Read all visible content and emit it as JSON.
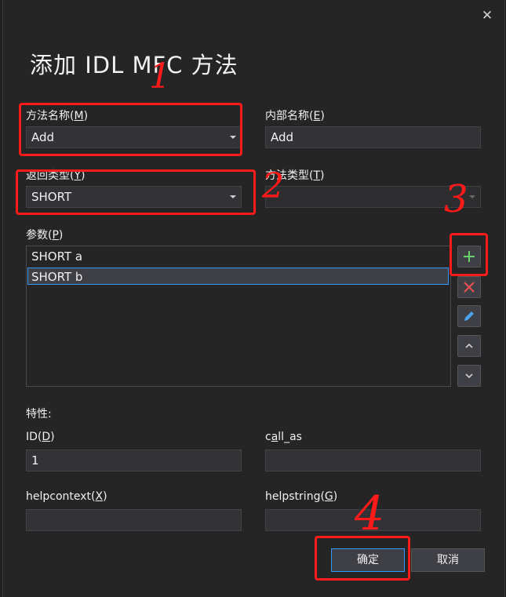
{
  "dialog": {
    "title": "添加 IDL MFC 方法",
    "close_glyph": "✕"
  },
  "method_name": {
    "label": "方法名称(",
    "key": "M",
    "suffix": ")",
    "value": "Add"
  },
  "internal_name": {
    "label": "内部名称(",
    "key": "E",
    "suffix": ")",
    "value": "Add"
  },
  "return_type": {
    "label": "返回类型(",
    "key": "Y",
    "suffix": ")",
    "value": "SHORT"
  },
  "method_type": {
    "label": "方法类型(",
    "key": "T",
    "suffix": ")",
    "value": ""
  },
  "parameters": {
    "label": "参数(",
    "key": "P",
    "suffix": ")",
    "items": [
      "SHORT  a",
      "SHORT b"
    ],
    "selected_index": 1
  },
  "side_buttons": [
    {
      "name": "add",
      "icon": "plus-icon",
      "color": "#6bd16b"
    },
    {
      "name": "delete",
      "icon": "x-icon",
      "color": "#f05050"
    },
    {
      "name": "edit",
      "icon": "pencil-icon",
      "color": "#4aa3f0"
    },
    {
      "name": "move-up",
      "icon": "chevron-up-icon",
      "color": "#d0d0d0"
    },
    {
      "name": "move-down",
      "icon": "chevron-down-icon",
      "color": "#d0d0d0"
    }
  ],
  "attributes": {
    "heading": "特性:",
    "id": {
      "label": "ID(",
      "key": "D",
      "suffix": ")",
      "value": "1"
    },
    "call_as": {
      "label_pre": "c",
      "key": "a",
      "label_post": "ll_as",
      "value": ""
    },
    "helpcontext": {
      "label": "helpcontext(",
      "key": "X",
      "suffix": ")",
      "value": ""
    },
    "helpstring": {
      "label": "helpstring(",
      "key": "G",
      "suffix": ")",
      "value": ""
    }
  },
  "buttons": {
    "ok": "确定",
    "cancel": "取消"
  },
  "annotations": {
    "color": "#ff1a1a",
    "labels": [
      "1",
      "2",
      "3",
      "4"
    ]
  }
}
